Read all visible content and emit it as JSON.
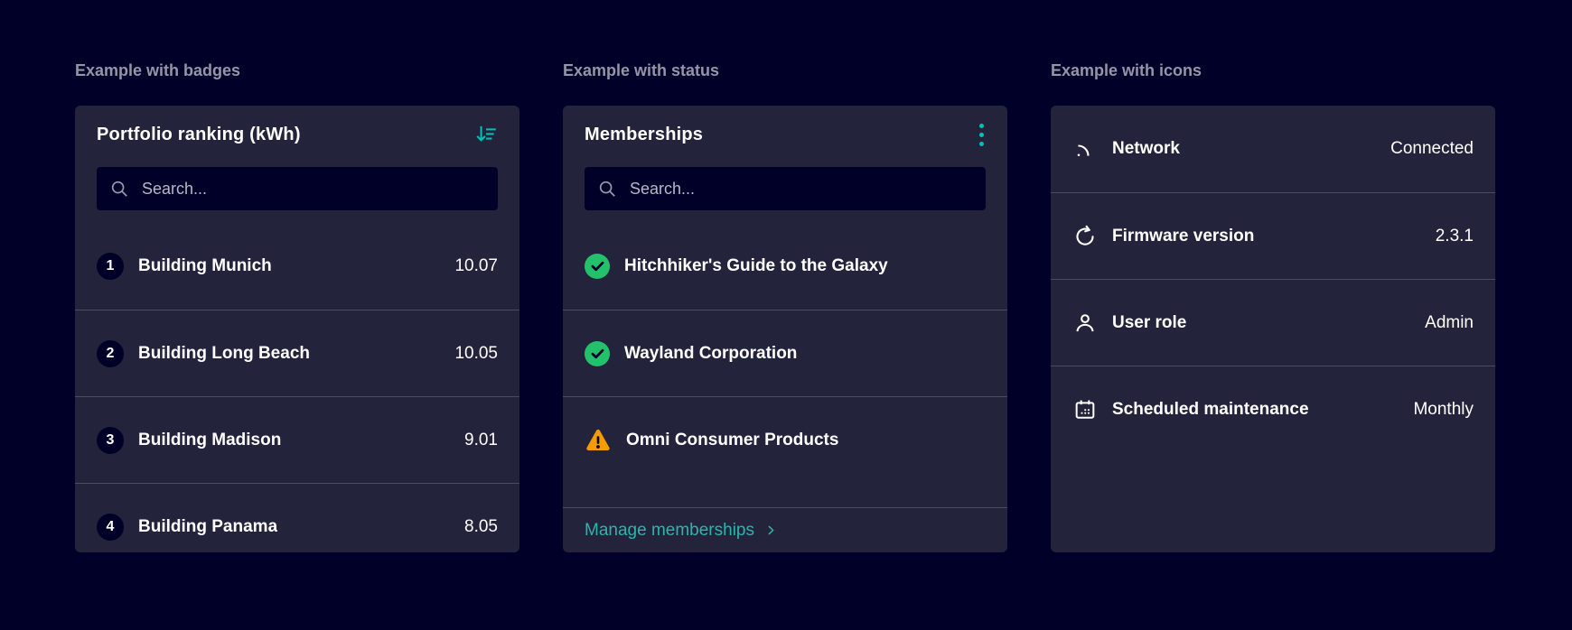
{
  "colors": {
    "page_background": "#000028",
    "card_background": "#23233c",
    "divider": "#4c4c66",
    "heading_text": "#9595a8",
    "text": "#ffffff",
    "accent_teal": "#00c1b6",
    "link_teal": "#2db5ac",
    "success_green": "#23c16b",
    "warning_orange": "#f79c00",
    "badge_background": "#000028",
    "search_background": "#000028"
  },
  "sections": [
    {
      "heading": "Example with badges",
      "card": {
        "title": "Portfolio ranking (kWh)",
        "header_icon": "sort-descending-icon",
        "search_placeholder": "Search...",
        "items": [
          {
            "badge": "1",
            "label": "Building Munich",
            "value": "10.07"
          },
          {
            "badge": "2",
            "label": "Building Long Beach",
            "value": "10.05"
          },
          {
            "badge": "3",
            "label": "Building Madison",
            "value": "9.01"
          },
          {
            "badge": "4",
            "label": "Building Panama",
            "value": "8.05"
          }
        ]
      }
    },
    {
      "heading": "Example with status",
      "card": {
        "title": "Memberships",
        "header_icon": "kebab-menu-icon",
        "search_placeholder": "Search...",
        "items": [
          {
            "status": "success",
            "label": "Hitchhiker's Guide to the Galaxy"
          },
          {
            "status": "success",
            "label": "Wayland Corporation"
          },
          {
            "status": "warning",
            "label": "Omni Consumer Products"
          }
        ],
        "footer_link_label": "Manage memberships"
      }
    },
    {
      "heading": "Example with icons",
      "card": {
        "items": [
          {
            "icon": "network-icon",
            "label": "Network",
            "value": "Connected"
          },
          {
            "icon": "firmware-refresh-icon",
            "label": "Firmware version",
            "value": "2.3.1"
          },
          {
            "icon": "user-icon",
            "label": "User role",
            "value": "Admin"
          },
          {
            "icon": "calendar-icon",
            "label": "Scheduled maintenance",
            "value": "Monthly"
          }
        ]
      }
    }
  ]
}
